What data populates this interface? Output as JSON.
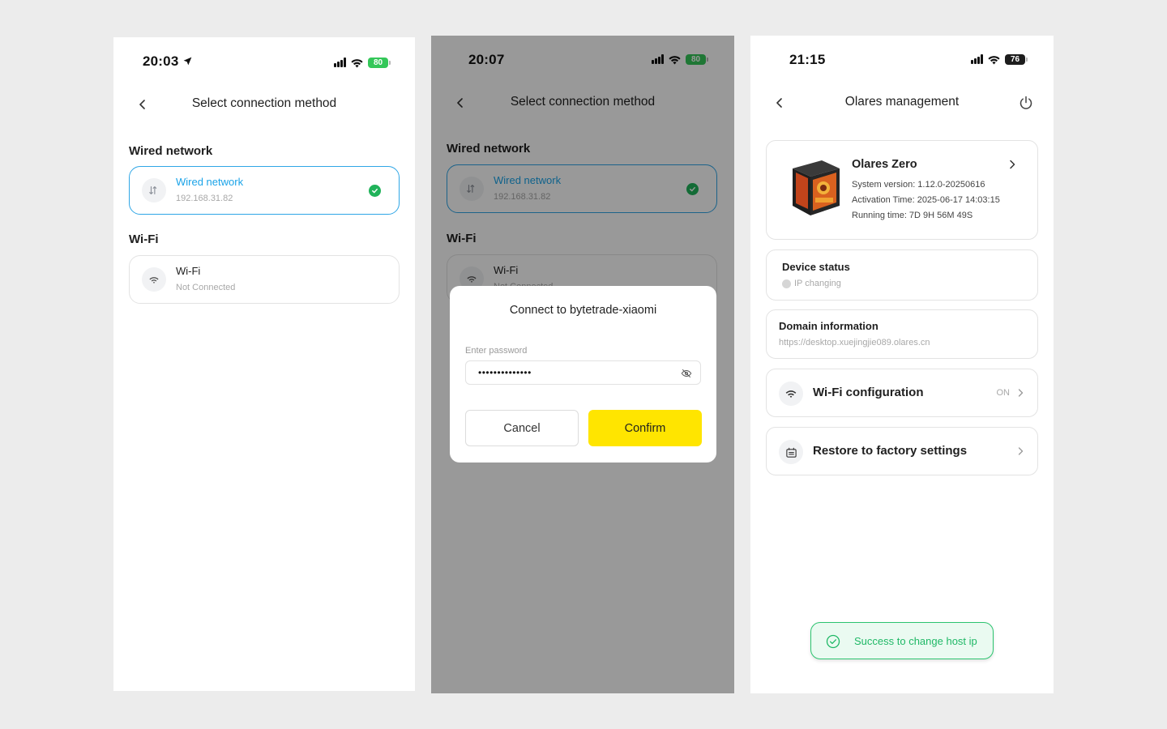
{
  "screen1": {
    "time": "20:03",
    "battery": "80",
    "title": "Select connection method",
    "wired_section": "Wired network",
    "wired_card": {
      "title": "Wired network",
      "ip": "192.168.31.82"
    },
    "wifi_section": "Wi-Fi",
    "wifi_card": {
      "title": "Wi-Fi",
      "status": "Not Connected"
    }
  },
  "screen2": {
    "time": "20:07",
    "battery": "80",
    "title": "Select connection method",
    "wired_section": "Wired network",
    "wired_card": {
      "title": "Wired network",
      "ip": "192.168.31.82"
    },
    "wifi_section": "Wi-Fi",
    "wifi_card": {
      "title": "Wi-Fi",
      "status": "Not Connected"
    },
    "dialog": {
      "title": "Connect to bytetrade-xiaomi",
      "password_label": "Enter password",
      "password_value": "••••••••••••••",
      "cancel_label": "Cancel",
      "confirm_label": "Confirm"
    }
  },
  "screen3": {
    "time": "21:15",
    "battery": "76",
    "title": "Olares management",
    "device": {
      "name": "Olares Zero",
      "system_version": "System version: 1.12.0-20250616",
      "activation_time": "Activation Time: 2025-06-17 14:03:15",
      "running_time": "Running time: 7D 9H 56M 49S"
    },
    "device_status": {
      "title": "Device status",
      "value": "IP changing"
    },
    "domain": {
      "title": "Domain information",
      "value": "https://desktop.xuejingjie089.olares.cn"
    },
    "wifi_config": {
      "label": "Wi-Fi configuration",
      "state": "ON"
    },
    "restore": {
      "label": "Restore to factory settings"
    },
    "toast": "Success to change host ip"
  },
  "colors": {
    "accent_blue": "#1aa3e8",
    "confirm_yellow": "#ffe500",
    "success_green": "#1fb866",
    "battery_green": "#34c759"
  },
  "icons": [
    "location-arrow-icon",
    "signal-icon",
    "wifi-icon",
    "battery-icon",
    "back-chevron-icon",
    "ethernet-icon",
    "check-circle-icon",
    "eye-off-icon",
    "power-icon",
    "chevron-right-icon",
    "factory-reset-icon",
    "success-check-icon"
  ]
}
